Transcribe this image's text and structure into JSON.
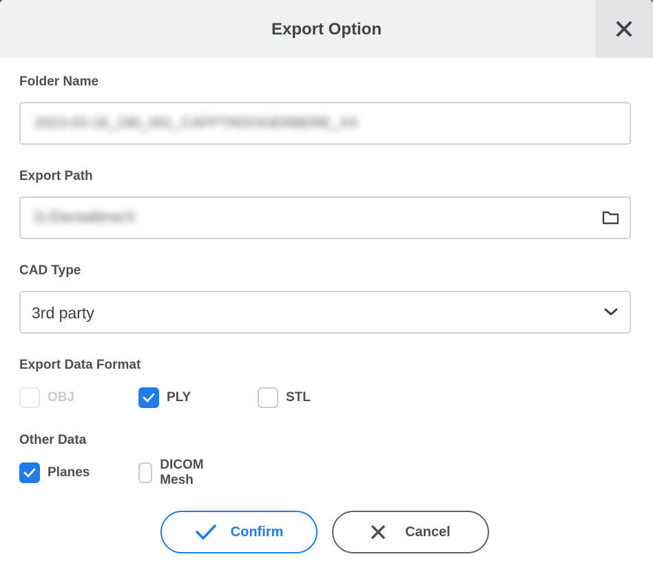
{
  "dialog": {
    "title": "Export Option",
    "close_icon": "close-icon"
  },
  "folder_name": {
    "label": "Folder Name",
    "value": "2023-03-16_190_001_CAFPTRDOGERBERE_XX"
  },
  "export_path": {
    "label": "Export Path",
    "value": "D:/Dentaltime/X",
    "icon": "folder-icon"
  },
  "cad_type": {
    "label": "CAD Type",
    "value": "3rd party",
    "icon": "chevron-down-icon"
  },
  "export_format": {
    "label": "Export Data Format",
    "options": [
      {
        "label": "OBJ",
        "checked": false,
        "disabled": true
      },
      {
        "label": "PLY",
        "checked": true,
        "disabled": false
      },
      {
        "label": "STL",
        "checked": false,
        "disabled": false
      }
    ]
  },
  "other_data": {
    "label": "Other Data",
    "options": [
      {
        "label": "Planes",
        "checked": true,
        "disabled": false
      },
      {
        "label": "DICOM Mesh",
        "checked": false,
        "disabled": false
      }
    ]
  },
  "buttons": {
    "confirm_label": "Confirm",
    "cancel_label": "Cancel"
  },
  "colors": {
    "accent": "#1f7ce8",
    "text": "#4a4f54",
    "header_bg": "#f0f1f1"
  }
}
